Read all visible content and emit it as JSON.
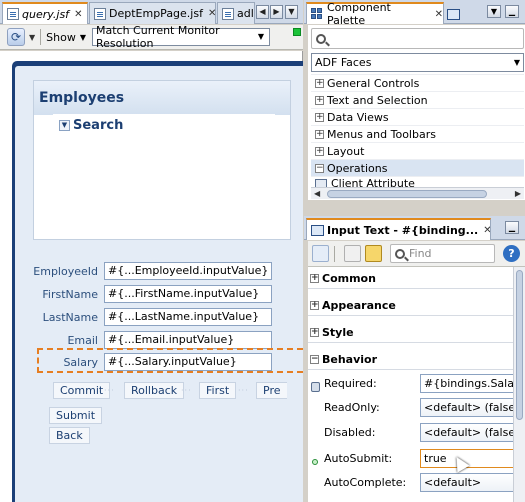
{
  "editor": {
    "tabs": [
      {
        "label": "query.jsf",
        "active": true
      },
      {
        "label": "DeptEmpPage.jsf",
        "active": false
      },
      {
        "label": "adl",
        "active": false
      }
    ],
    "toolbar": {
      "show_label": "Show",
      "resolution": "Match Current Monitor Resolution"
    },
    "page": {
      "panel_title": "Employees",
      "search_label": "Search",
      "fields": [
        {
          "label": "EmployeeId",
          "value": "#{...EmployeeId.inputValue}"
        },
        {
          "label": "FirstName",
          "value": "#{...FirstName.inputValue}"
        },
        {
          "label": "LastName",
          "value": "#{...LastName.inputValue}"
        },
        {
          "label": "Email",
          "value": "#{...Email.inputValue}"
        },
        {
          "label": "Salary",
          "value": "#{...Salary.inputValue}"
        }
      ],
      "buttons": [
        "Commit",
        "Rollback",
        "First",
        "Pre"
      ],
      "submit": "Submit",
      "back": "Back"
    }
  },
  "palette": {
    "tab_label": "Component Palette",
    "search_placeholder": "",
    "library": "ADF Faces",
    "categories": [
      {
        "label": "General Controls",
        "expanded": false
      },
      {
        "label": "Text and Selection",
        "expanded": false
      },
      {
        "label": "Data Views",
        "expanded": false
      },
      {
        "label": "Menus and Toolbars",
        "expanded": false
      },
      {
        "label": "Layout",
        "expanded": false
      },
      {
        "label": "Operations",
        "expanded": true
      }
    ],
    "child_partial": "Client Attribute"
  },
  "inspector": {
    "tab_label": "Input Text - #{binding...",
    "find_placeholder": "Find",
    "sections": [
      {
        "label": "Common",
        "expanded": false
      },
      {
        "label": "Appearance",
        "expanded": false
      },
      {
        "label": "Style",
        "expanded": false
      },
      {
        "label": "Behavior",
        "expanded": true
      }
    ],
    "properties": [
      {
        "label": "Required:",
        "value": "#{bindings.Salary.",
        "icon": "database-icon"
      },
      {
        "label": "ReadOnly:",
        "value": "<default> (false)"
      },
      {
        "label": "Disabled:",
        "value": "<default> (false)"
      },
      {
        "label": "AutoSubmit:",
        "value": "true",
        "icon": "modified-dot-icon"
      },
      {
        "label": "AutoComplete:",
        "value": "<default>"
      }
    ]
  },
  "colors": {
    "accent_orange": "#e08a1e",
    "frame_blue": "#1b3f78",
    "label_blue": "#2c4f7d",
    "indicator_green": "#1cc339"
  }
}
